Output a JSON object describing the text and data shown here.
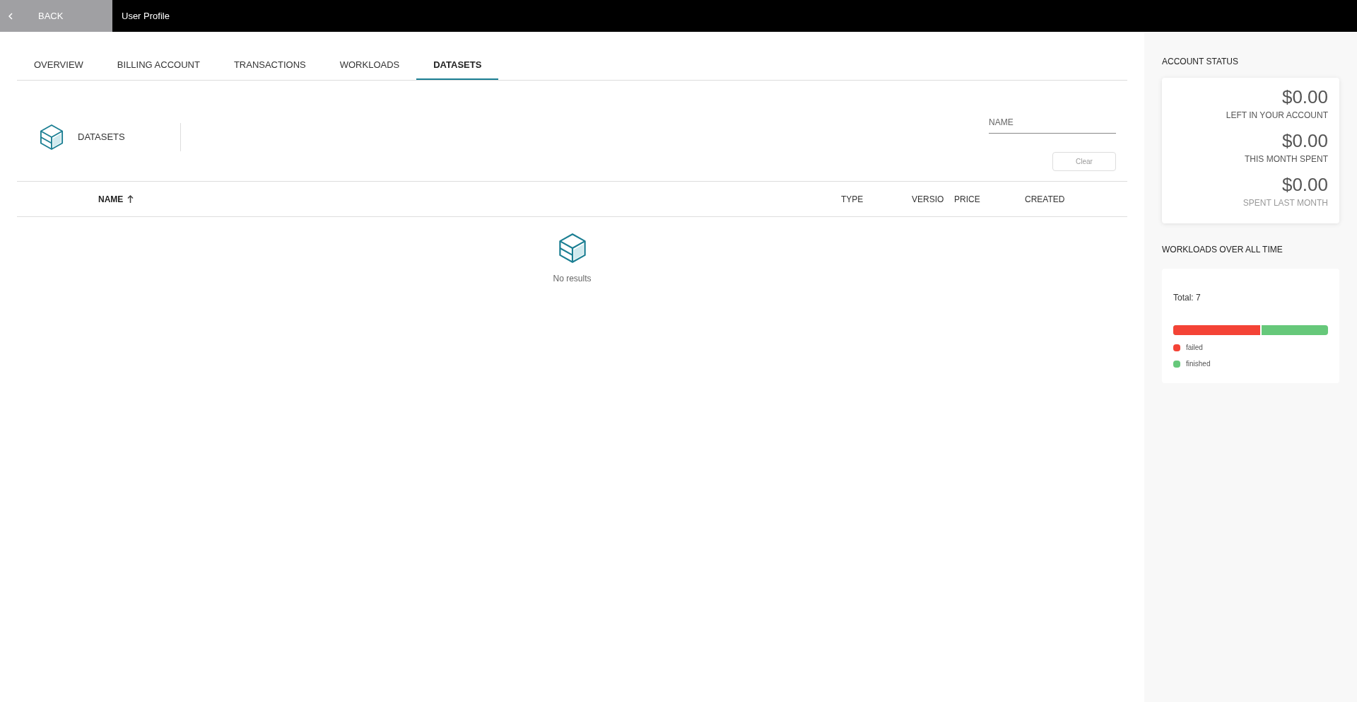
{
  "header": {
    "back_label": "BACK",
    "title": "User Profile"
  },
  "tabs": [
    {
      "label": "OVERVIEW",
      "selected": false
    },
    {
      "label": "BILLING ACCOUNT",
      "selected": false
    },
    {
      "label": "TRANSACTIONS",
      "selected": false
    },
    {
      "label": "WORKLOADS",
      "selected": false
    },
    {
      "label": "DATASETS",
      "selected": true
    }
  ],
  "section": {
    "title": "DATASETS"
  },
  "filter": {
    "placeholder": "NAME",
    "clear_label": "Clear"
  },
  "table": {
    "columns": [
      {
        "label": "NAME",
        "sorted": true
      },
      {
        "label": "TYPE",
        "sorted": false
      },
      {
        "label": "VERSIO",
        "sorted": false
      },
      {
        "label": "PRICE",
        "sorted": false
      },
      {
        "label": "CREATED",
        "sorted": false
      }
    ],
    "empty_text": "No results"
  },
  "account_status": {
    "title": "ACCOUNT STATUS",
    "items": [
      {
        "amount": "$0.00",
        "label": "LEFT IN YOUR ACCOUNT"
      },
      {
        "amount": "$0.00",
        "label": "THIS MONTH SPENT"
      },
      {
        "amount": "$0.00",
        "label": "SPENT LAST MONTH"
      }
    ]
  },
  "workloads": {
    "title": "WORKLOADS OVER ALL TIME",
    "total": "Total: 7",
    "level": 0.57,
    "segments": [
      {
        "label": "failed",
        "color": "#f44336"
      },
      {
        "label": "finished",
        "color": "#66c87a"
      }
    ]
  }
}
